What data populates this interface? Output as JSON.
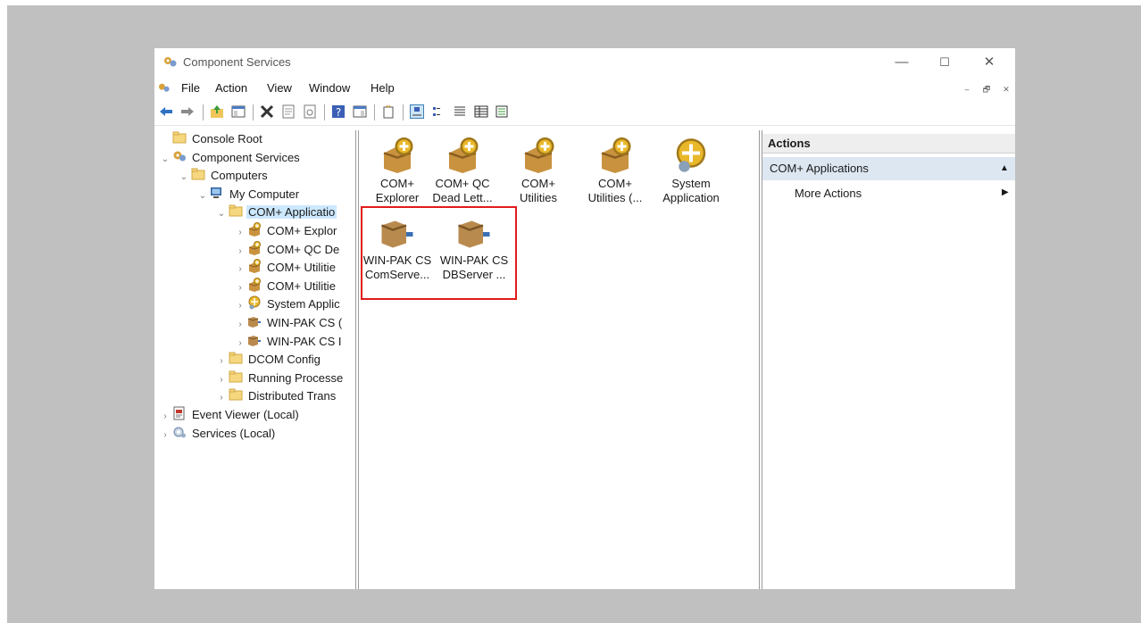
{
  "window": {
    "title": "Component Services",
    "minimize": "—",
    "maximize": "☐",
    "close": "✕"
  },
  "menubar": {
    "items": [
      "File",
      "Action",
      "View",
      "Window",
      "Help"
    ],
    "doc_controls": [
      "–",
      "🗗",
      "✕"
    ]
  },
  "toolbar": {
    "icons": [
      "back-icon",
      "forward-icon",
      "up-folder-icon",
      "show-hide-tree-icon",
      "delete-icon",
      "properties-icon",
      "refresh-icon",
      "help-icon",
      "show-hide-action-icon",
      "new-window-icon",
      "large-icons-view-icon",
      "small-icons-view-icon",
      "list-view-icon",
      "detail-view-icon",
      "export-list-icon"
    ]
  },
  "tree": {
    "items": [
      {
        "label": "Console Root",
        "level": 0,
        "expander": "",
        "icon": "folder-icon"
      },
      {
        "label": "Component Services",
        "level": 0,
        "expander": "⌄",
        "icon": "component-services-icon"
      },
      {
        "label": "Computers",
        "level": 1,
        "expander": "⌄",
        "icon": "folder-icon"
      },
      {
        "label": "My Computer",
        "level": 2,
        "expander": "⌄",
        "icon": "computer-icon"
      },
      {
        "label": "COM+ Applicatio",
        "level": 3,
        "expander": "⌄",
        "icon": "folder-icon",
        "selected": true
      },
      {
        "label": "COM+ Explor",
        "level": 4,
        "expander": "›",
        "icon": "com-app-icon"
      },
      {
        "label": "COM+ QC De",
        "level": 4,
        "expander": "›",
        "icon": "com-app-icon"
      },
      {
        "label": "COM+ Utilitie",
        "level": 4,
        "expander": "›",
        "icon": "com-app-icon"
      },
      {
        "label": "COM+ Utilitie",
        "level": 4,
        "expander": "›",
        "icon": "com-app-icon"
      },
      {
        "label": "System Applic",
        "level": 4,
        "expander": "›",
        "icon": "system-app-icon"
      },
      {
        "label": "WIN-PAK CS (",
        "level": 4,
        "expander": "›",
        "icon": "package-icon"
      },
      {
        "label": "WIN-PAK CS I",
        "level": 4,
        "expander": "›",
        "icon": "package-icon"
      },
      {
        "label": "DCOM Config",
        "level": 3,
        "expander": "›",
        "icon": "folder-icon"
      },
      {
        "label": "Running Processe",
        "level": 3,
        "expander": "›",
        "icon": "folder-icon"
      },
      {
        "label": "Distributed Trans",
        "level": 3,
        "expander": "›",
        "icon": "folder-icon"
      },
      {
        "label": "Event Viewer (Local)",
        "level": 0,
        "expander": "›",
        "icon": "event-viewer-icon"
      },
      {
        "label": "Services (Local)",
        "level": 0,
        "expander": "›",
        "icon": "services-icon"
      }
    ]
  },
  "listview": {
    "items": [
      {
        "line1": "COM+",
        "line2": "Explorer",
        "icon": "com-app-icon"
      },
      {
        "line1": "COM+ QC",
        "line2": "Dead Lett...",
        "icon": "com-app-icon"
      },
      {
        "line1": "COM+",
        "line2": "Utilities",
        "icon": "com-app-icon"
      },
      {
        "line1": "COM+",
        "line2": "Utilities (...",
        "icon": "com-app-icon"
      },
      {
        "line1": "System",
        "line2": "Application",
        "icon": "system-app-icon"
      },
      {
        "line1": "WIN-PAK CS",
        "line2": "ComServe...",
        "icon": "package-icon"
      },
      {
        "line1": "WIN-PAK CS",
        "line2": "DBServer ...",
        "icon": "package-icon"
      }
    ]
  },
  "actions": {
    "header": "Actions",
    "section": "COM+ Applications",
    "section_caret": "▲",
    "items": [
      {
        "label": "More Actions",
        "caret": "▶"
      }
    ]
  },
  "colors": {
    "highlight_box": "#e01b1b",
    "selection": "#cce8ff",
    "section_bg": "#dde7f2"
  }
}
